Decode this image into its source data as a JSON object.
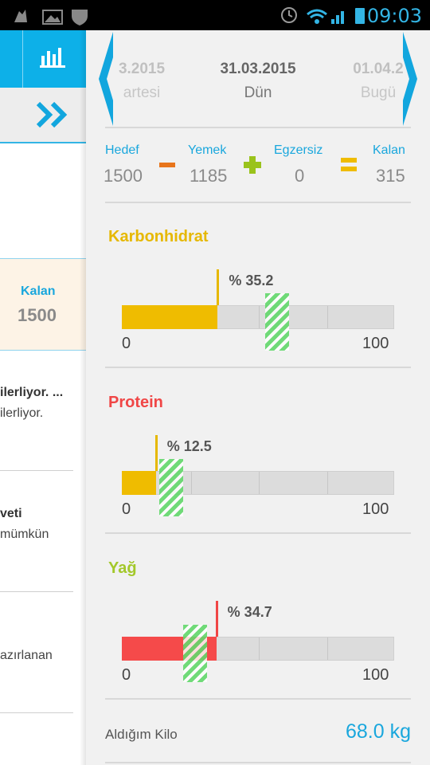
{
  "status_bar": {
    "time": "09:03"
  },
  "left_panel": {
    "kalan_label": "Kalan",
    "kalan_value": "1500",
    "texts": [
      "ilerliyor. ...",
      "ilerliyor.",
      "veti",
      "mümkün",
      "azırlanan"
    ]
  },
  "dates": [
    {
      "date": "3.2015",
      "name": "artesi"
    },
    {
      "date": "31.03.2015",
      "name": "Dün"
    },
    {
      "date": "01.04.2",
      "name": "Bugü"
    }
  ],
  "summary": {
    "hedef_label": "Hedef",
    "hedef_value": "1500",
    "yemek_label": "Yemek",
    "yemek_value": "1185",
    "egzersiz_label": "Egzersiz",
    "egzersiz_value": "0",
    "kalan_label": "Kalan",
    "kalan_value": "315"
  },
  "macros": [
    {
      "name": "Karbonhidrat",
      "percent_label": "% 35.2",
      "percent": 35.2,
      "target_percent": 57,
      "color": "#e6b800",
      "fill_color": "#efbc00",
      "title_color": "#e6b800",
      "axis_min": "0",
      "axis_max": "100"
    },
    {
      "name": "Protein",
      "percent_label": "% 12.5",
      "percent": 12.5,
      "target_percent": 18,
      "color": "#e6b800",
      "fill_color": "#efbc00",
      "title_color": "#f04646",
      "axis_min": "0",
      "axis_max": "100"
    },
    {
      "name": "Yağ",
      "percent_label": "% 34.7",
      "percent": 34.7,
      "target_percent": 27,
      "color": "#f04646",
      "fill_color": "#f54a4a",
      "title_color": "#a3c82a",
      "axis_min": "0",
      "axis_max": "100"
    }
  ],
  "weight": {
    "label": "Aldığım Kilo",
    "value": "68.0 kg"
  }
}
